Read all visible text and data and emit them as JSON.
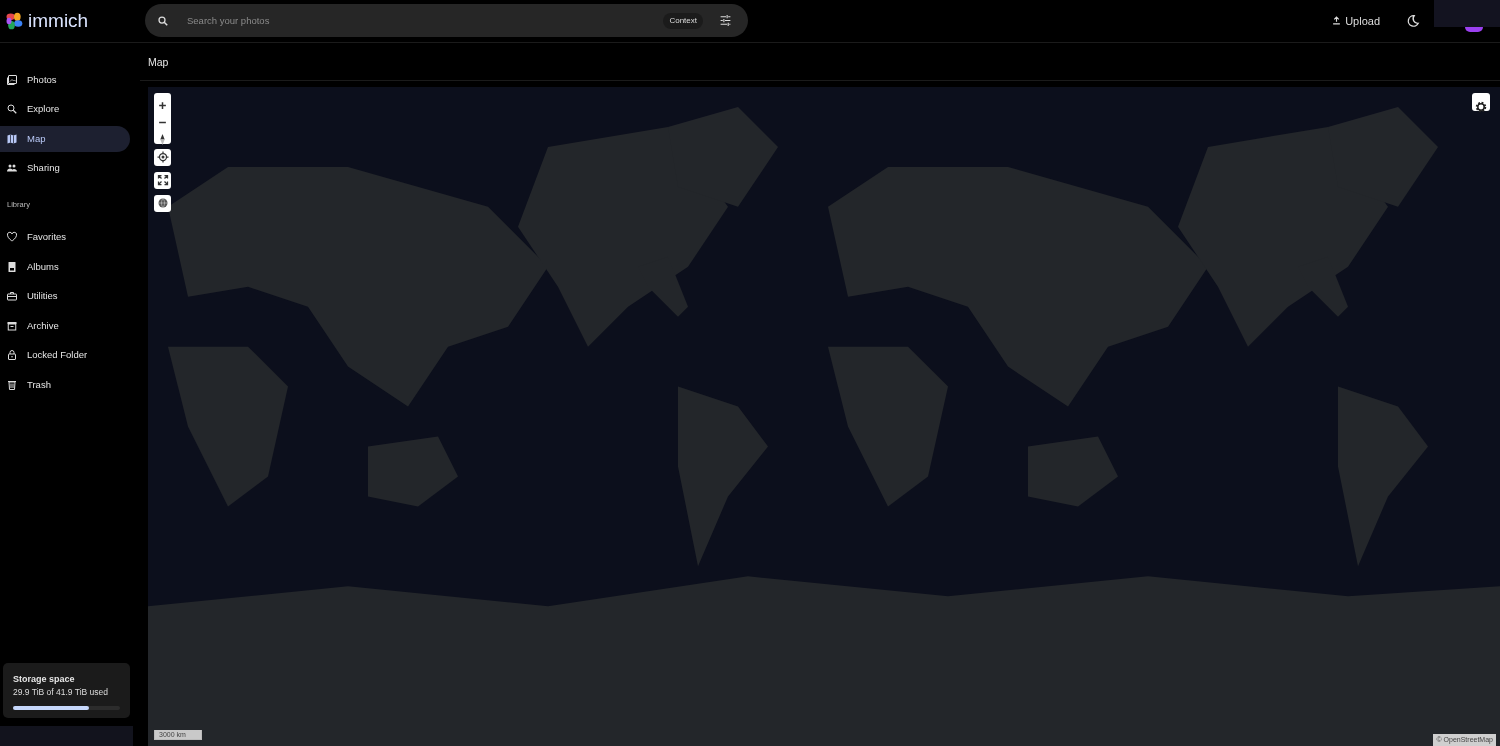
{
  "app": {
    "name": "immich"
  },
  "search": {
    "placeholder": "Search your photos",
    "context_label": "Context"
  },
  "header_actions": {
    "upload_label": "Upload"
  },
  "sidebar": {
    "items": [
      {
        "label": "Photos",
        "selected": false
      },
      {
        "label": "Explore",
        "selected": false
      },
      {
        "label": "Map",
        "selected": true
      },
      {
        "label": "Sharing",
        "selected": false
      }
    ],
    "section_title": "Library",
    "library_items": [
      {
        "label": "Favorites",
        "selected": false
      },
      {
        "label": "Albums",
        "selected": false
      },
      {
        "label": "Utilities",
        "selected": false
      },
      {
        "label": "Archive",
        "selected": false
      },
      {
        "label": "Locked Folder",
        "selected": false
      },
      {
        "label": "Trash",
        "selected": false
      }
    ],
    "storage": {
      "title": "Storage space",
      "usage": "29.9 TiB of 41.9 TiB used",
      "level": 0.71
    }
  },
  "page_title": "Map",
  "map": {
    "scale_label": "3000 km",
    "attribution": "© OpenStreetMap"
  }
}
